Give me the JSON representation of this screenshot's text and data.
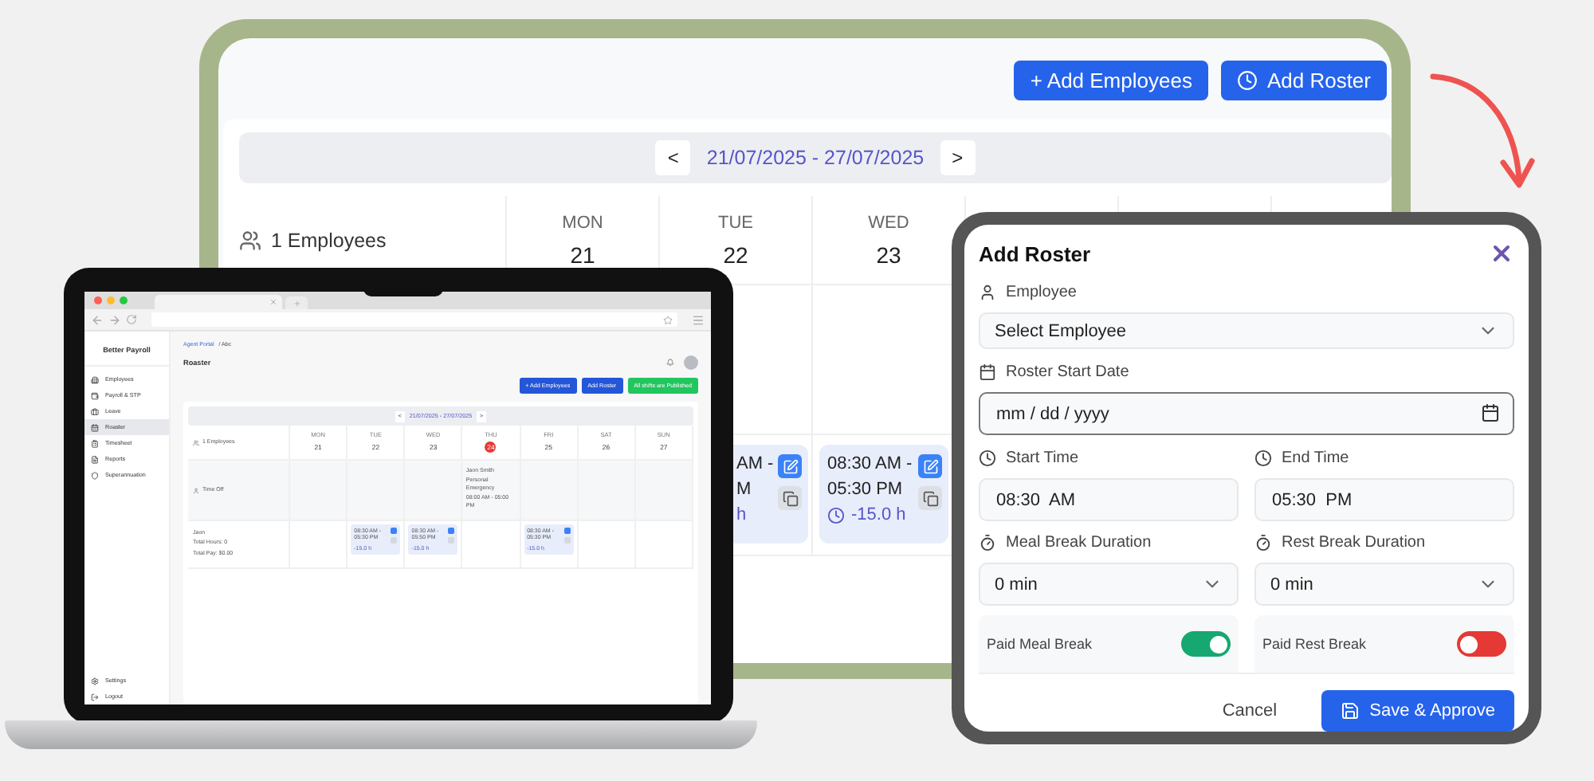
{
  "tablet": {
    "buttons": [
      {
        "label": "+ Add Employees",
        "kind": "plain"
      },
      {
        "label": "Add Roster",
        "kind": "clock"
      }
    ],
    "prev": "<",
    "next": ">",
    "date_range": "21/07/2025 - 27/07/2025",
    "employees": "1 Employees",
    "days": [
      {
        "name": "MON",
        "date": "21"
      },
      {
        "name": "TUE",
        "date": "22"
      },
      {
        "name": "WED",
        "date": "23"
      }
    ],
    "shifts": [
      {
        "lines": [
          "AM -",
          "M"
        ],
        "hours": "h",
        "clipped": true
      },
      {
        "lines": [
          "08:30 AM -",
          "05:30 PM"
        ],
        "hours": "-15.0 h",
        "clipped": false
      }
    ]
  },
  "laptop": {
    "brand": "Better Payroll",
    "sidebar": [
      {
        "label": "Employees",
        "selected": false
      },
      {
        "label": "Payroll & STP",
        "selected": false
      },
      {
        "label": "Leave",
        "selected": false
      },
      {
        "label": "Roaster",
        "selected": true
      },
      {
        "label": "Timesheet",
        "selected": false
      },
      {
        "label": "Reports",
        "selected": false
      },
      {
        "label": "Superannuation",
        "selected": false
      }
    ],
    "sidebar_bottom": [
      {
        "label": "Settings"
      },
      {
        "label": "Logout"
      }
    ],
    "breadcrumb": [
      {
        "label": "Agent Portal",
        "kind": "link"
      },
      {
        "label": "/ Abc",
        "kind": "text"
      }
    ],
    "title": "Roaster",
    "buttons": [
      {
        "label": "+ Add Employees",
        "kind": "blue"
      },
      {
        "label": "Add Roster",
        "kind": "blue"
      },
      {
        "label": "All shifts are Published",
        "kind": "green"
      }
    ],
    "prev": "<",
    "next": ">",
    "date_range": "21/07/2025 - 27/07/2025",
    "employees": "1 Employees",
    "time_off_label": "Time Off",
    "employee": {
      "name": "Jaon",
      "lines": [
        "Total Hours: 0",
        "Total Pay: $0.00"
      ]
    },
    "days": [
      {
        "name": "MON",
        "date": "21",
        "today": false
      },
      {
        "name": "TUE",
        "date": "22",
        "today": false,
        "shift": {
          "time": "08:30 AM - 05:30 PM",
          "hours": "-15.0 h"
        }
      },
      {
        "name": "WED",
        "date": "23",
        "today": false,
        "shift": {
          "time": "08:30 AM - 05:50 PM",
          "hours": "-15.0 h"
        }
      },
      {
        "name": "THU",
        "date": "24",
        "today": true,
        "time_off": [
          "Jaon Smith",
          "Personal Emergency",
          "08:00 AM - 05:00 PM"
        ]
      },
      {
        "name": "FRI",
        "date": "25",
        "today": false,
        "shift": {
          "time": "08:30 AM - 05:30 PM",
          "hours": "-15.0 h"
        }
      },
      {
        "name": "SAT",
        "date": "26",
        "today": false
      },
      {
        "name": "SUN",
        "date": "27",
        "today": false
      }
    ]
  },
  "modal": {
    "title": "Add Roster",
    "employee": {
      "label": "Employee",
      "value": "Select Employee"
    },
    "start_date": {
      "label": "Roster Start Date",
      "placeholder": "mm / dd / yyyy"
    },
    "times": [
      {
        "label": "Start Time",
        "value": "08:30  AM"
      },
      {
        "label": "End Time",
        "value": "05:30  PM"
      }
    ],
    "breaks": [
      {
        "label": "Meal Break Duration",
        "value": "0 min"
      },
      {
        "label": "Rest Break Duration",
        "value": "0 min"
      }
    ],
    "paid": [
      {
        "label": "Paid Meal Break",
        "on": true
      },
      {
        "label": "Paid Rest Break",
        "on": false
      }
    ],
    "buttons": [
      {
        "label": "Cancel",
        "kind": "secondary"
      },
      {
        "label": "Save & Approve",
        "kind": "primary"
      }
    ]
  }
}
